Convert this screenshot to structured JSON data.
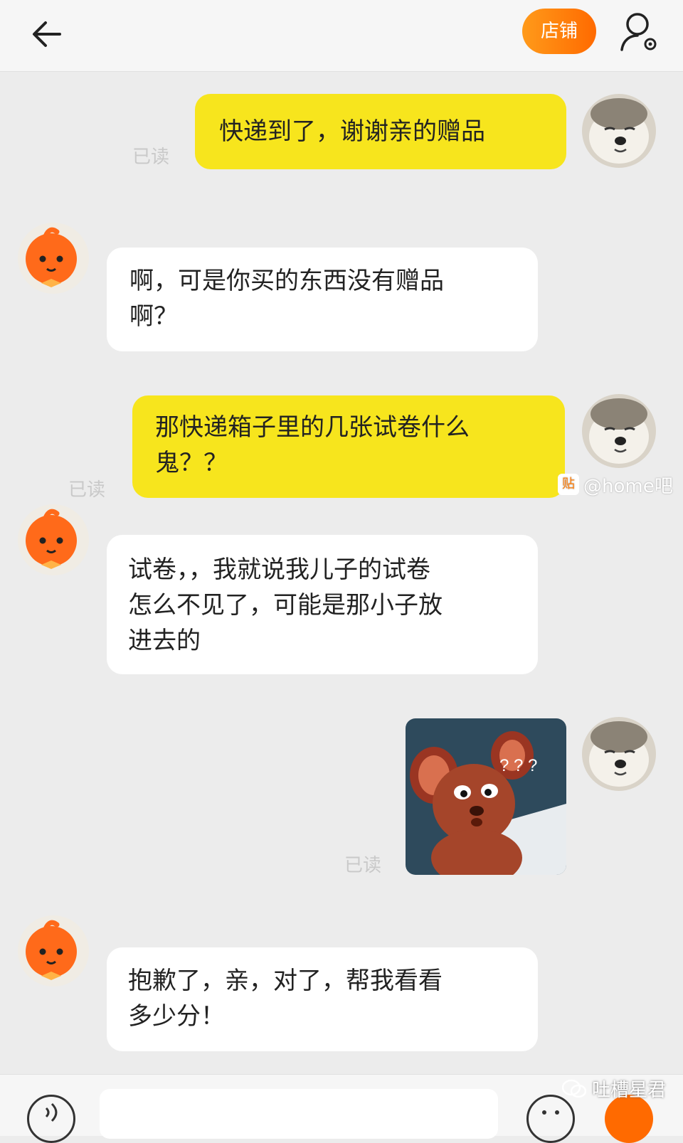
{
  "header": {
    "back_icon": "arrow-left-icon",
    "shop_button_label": "店铺",
    "user_icon": "user-settings-icon",
    "accent_color": "#ff7a00"
  },
  "messages": [
    {
      "sender": "me",
      "text": "快递到了，谢谢亲的赠品",
      "status": "已读"
    },
    {
      "sender": "them",
      "lines": [
        "啊，可是你买的东西没有赠品",
        "啊？"
      ]
    },
    {
      "sender": "me",
      "lines": [
        "那快递箱子里的几张试卷什么",
        "鬼？？"
      ],
      "status": "已读"
    },
    {
      "sender": "them",
      "lines": [
        "试卷，，我就说我儿子的试卷",
        "怎么不见了，可能是那小子放",
        "进去的"
      ]
    },
    {
      "sender": "me",
      "image": "jerry-mouse-confused-sticker",
      "image_text": "? ? ?",
      "status": "已读"
    },
    {
      "sender": "them",
      "lines": [
        "抱歉了，亲，对了，帮我看看",
        "多少分！"
      ]
    }
  ],
  "watermarks": {
    "middle_icon_text": "贴",
    "middle_text": "@home吧",
    "footer_text": "吐槽星君"
  },
  "colors": {
    "my_bubble": "#f7e51d",
    "their_bubble": "#ffffff",
    "background": "#ececec"
  }
}
